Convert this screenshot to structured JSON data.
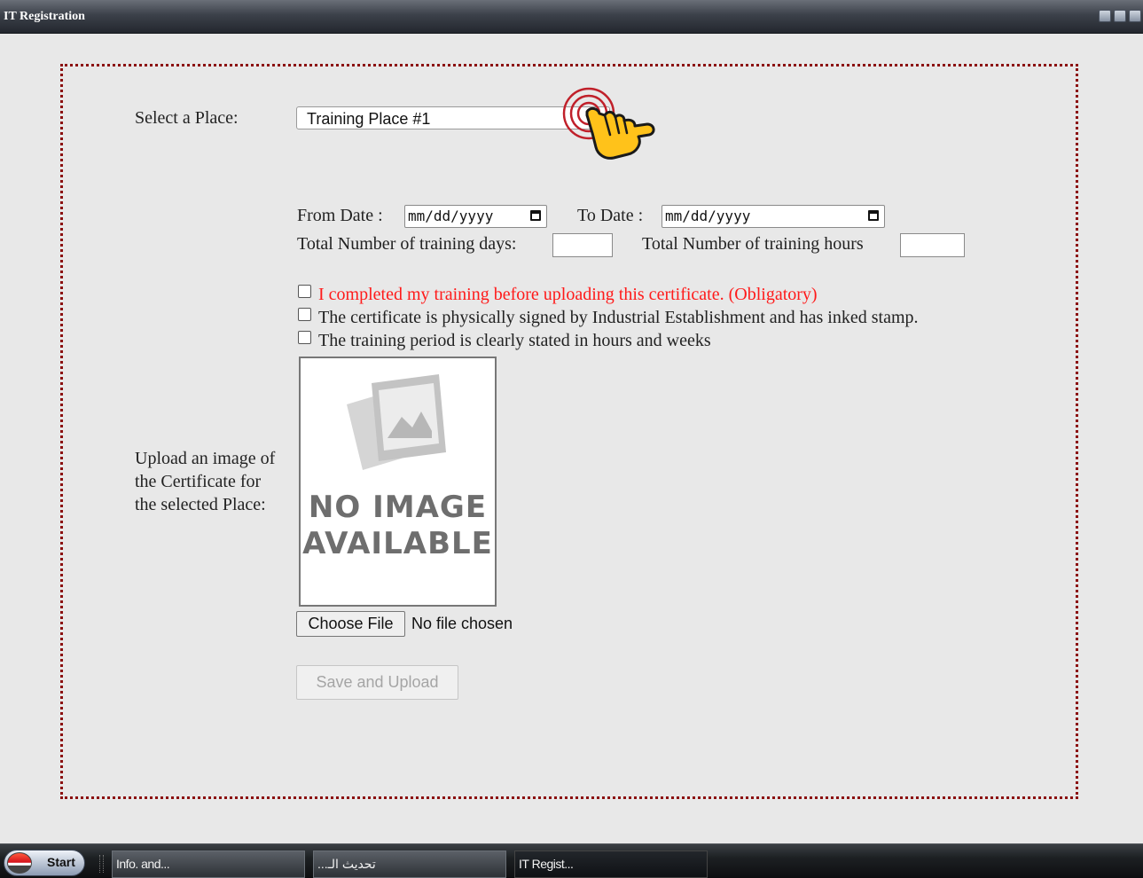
{
  "window": {
    "title": "IT Registration"
  },
  "form": {
    "place_label": "Select a Place:",
    "place_value": "Training Place #1",
    "from_date_label": "From Date :",
    "from_date_placeholder": "mm/dd/yyyy",
    "to_date_label": "To Date :",
    "to_date_placeholder": "mm/dd/yyyy",
    "days_label": "Total Number of training days:",
    "hours_label": "Total Number of training hours",
    "checkboxes": [
      {
        "label": "I completed my training before uploading this certificate. (Obligatory)",
        "checked": false,
        "color": "#ff1a1a"
      },
      {
        "label": "The certificate is physically signed by Industrial Establishment and has inked stamp.",
        "checked": false
      },
      {
        "label": "The training period is clearly stated in hours and weeks",
        "checked": false
      }
    ],
    "upload_label_lines": [
      "Upload an image of",
      "the Certificate for",
      "the selected Place:"
    ],
    "no_image_lines": [
      "NO IMAGE",
      "AVAILABLE"
    ],
    "choose_file_label": "Choose File",
    "file_status": "No file chosen",
    "save_label": "Save and Upload"
  },
  "taskbar": {
    "start_label": "Start",
    "items": [
      {
        "label": "Info. and..."
      },
      {
        "label": "...تحديث الـ"
      },
      {
        "label": "IT Regist...",
        "active": true
      }
    ]
  },
  "colors": {
    "frame": "#8b0f0f",
    "required_text": "#ff1a1a",
    "cursor": "#ffc21a"
  },
  "icons": [
    "calendar-icon",
    "no-image-placeholder-icon",
    "pointer-hand-cursor-icon",
    "start-orb-icon"
  ]
}
